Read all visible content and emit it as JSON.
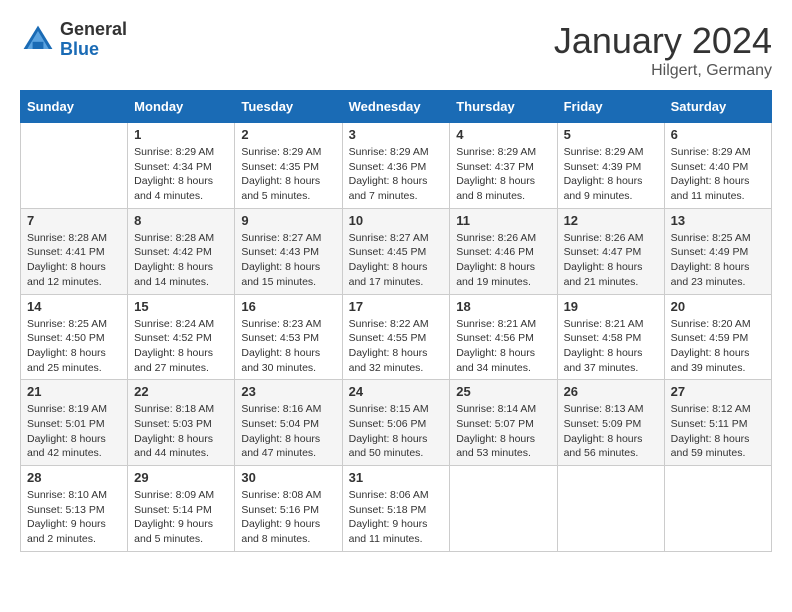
{
  "header": {
    "logo_general": "General",
    "logo_blue": "Blue",
    "month_title": "January 2024",
    "location": "Hilgert, Germany"
  },
  "days_of_week": [
    "Sunday",
    "Monday",
    "Tuesday",
    "Wednesday",
    "Thursday",
    "Friday",
    "Saturday"
  ],
  "weeks": [
    [
      {
        "day": "",
        "sunrise": "",
        "sunset": "",
        "daylight": ""
      },
      {
        "day": "1",
        "sunrise": "Sunrise: 8:29 AM",
        "sunset": "Sunset: 4:34 PM",
        "daylight": "Daylight: 8 hours and 4 minutes."
      },
      {
        "day": "2",
        "sunrise": "Sunrise: 8:29 AM",
        "sunset": "Sunset: 4:35 PM",
        "daylight": "Daylight: 8 hours and 5 minutes."
      },
      {
        "day": "3",
        "sunrise": "Sunrise: 8:29 AM",
        "sunset": "Sunset: 4:36 PM",
        "daylight": "Daylight: 8 hours and 7 minutes."
      },
      {
        "day": "4",
        "sunrise": "Sunrise: 8:29 AM",
        "sunset": "Sunset: 4:37 PM",
        "daylight": "Daylight: 8 hours and 8 minutes."
      },
      {
        "day": "5",
        "sunrise": "Sunrise: 8:29 AM",
        "sunset": "Sunset: 4:39 PM",
        "daylight": "Daylight: 8 hours and 9 minutes."
      },
      {
        "day": "6",
        "sunrise": "Sunrise: 8:29 AM",
        "sunset": "Sunset: 4:40 PM",
        "daylight": "Daylight: 8 hours and 11 minutes."
      }
    ],
    [
      {
        "day": "7",
        "sunrise": "Sunrise: 8:28 AM",
        "sunset": "Sunset: 4:41 PM",
        "daylight": "Daylight: 8 hours and 12 minutes."
      },
      {
        "day": "8",
        "sunrise": "Sunrise: 8:28 AM",
        "sunset": "Sunset: 4:42 PM",
        "daylight": "Daylight: 8 hours and 14 minutes."
      },
      {
        "day": "9",
        "sunrise": "Sunrise: 8:27 AM",
        "sunset": "Sunset: 4:43 PM",
        "daylight": "Daylight: 8 hours and 15 minutes."
      },
      {
        "day": "10",
        "sunrise": "Sunrise: 8:27 AM",
        "sunset": "Sunset: 4:45 PM",
        "daylight": "Daylight: 8 hours and 17 minutes."
      },
      {
        "day": "11",
        "sunrise": "Sunrise: 8:26 AM",
        "sunset": "Sunset: 4:46 PM",
        "daylight": "Daylight: 8 hours and 19 minutes."
      },
      {
        "day": "12",
        "sunrise": "Sunrise: 8:26 AM",
        "sunset": "Sunset: 4:47 PM",
        "daylight": "Daylight: 8 hours and 21 minutes."
      },
      {
        "day": "13",
        "sunrise": "Sunrise: 8:25 AM",
        "sunset": "Sunset: 4:49 PM",
        "daylight": "Daylight: 8 hours and 23 minutes."
      }
    ],
    [
      {
        "day": "14",
        "sunrise": "Sunrise: 8:25 AM",
        "sunset": "Sunset: 4:50 PM",
        "daylight": "Daylight: 8 hours and 25 minutes."
      },
      {
        "day": "15",
        "sunrise": "Sunrise: 8:24 AM",
        "sunset": "Sunset: 4:52 PM",
        "daylight": "Daylight: 8 hours and 27 minutes."
      },
      {
        "day": "16",
        "sunrise": "Sunrise: 8:23 AM",
        "sunset": "Sunset: 4:53 PM",
        "daylight": "Daylight: 8 hours and 30 minutes."
      },
      {
        "day": "17",
        "sunrise": "Sunrise: 8:22 AM",
        "sunset": "Sunset: 4:55 PM",
        "daylight": "Daylight: 8 hours and 32 minutes."
      },
      {
        "day": "18",
        "sunrise": "Sunrise: 8:21 AM",
        "sunset": "Sunset: 4:56 PM",
        "daylight": "Daylight: 8 hours and 34 minutes."
      },
      {
        "day": "19",
        "sunrise": "Sunrise: 8:21 AM",
        "sunset": "Sunset: 4:58 PM",
        "daylight": "Daylight: 8 hours and 37 minutes."
      },
      {
        "day": "20",
        "sunrise": "Sunrise: 8:20 AM",
        "sunset": "Sunset: 4:59 PM",
        "daylight": "Daylight: 8 hours and 39 minutes."
      }
    ],
    [
      {
        "day": "21",
        "sunrise": "Sunrise: 8:19 AM",
        "sunset": "Sunset: 5:01 PM",
        "daylight": "Daylight: 8 hours and 42 minutes."
      },
      {
        "day": "22",
        "sunrise": "Sunrise: 8:18 AM",
        "sunset": "Sunset: 5:03 PM",
        "daylight": "Daylight: 8 hours and 44 minutes."
      },
      {
        "day": "23",
        "sunrise": "Sunrise: 8:16 AM",
        "sunset": "Sunset: 5:04 PM",
        "daylight": "Daylight: 8 hours and 47 minutes."
      },
      {
        "day": "24",
        "sunrise": "Sunrise: 8:15 AM",
        "sunset": "Sunset: 5:06 PM",
        "daylight": "Daylight: 8 hours and 50 minutes."
      },
      {
        "day": "25",
        "sunrise": "Sunrise: 8:14 AM",
        "sunset": "Sunset: 5:07 PM",
        "daylight": "Daylight: 8 hours and 53 minutes."
      },
      {
        "day": "26",
        "sunrise": "Sunrise: 8:13 AM",
        "sunset": "Sunset: 5:09 PM",
        "daylight": "Daylight: 8 hours and 56 minutes."
      },
      {
        "day": "27",
        "sunrise": "Sunrise: 8:12 AM",
        "sunset": "Sunset: 5:11 PM",
        "daylight": "Daylight: 8 hours and 59 minutes."
      }
    ],
    [
      {
        "day": "28",
        "sunrise": "Sunrise: 8:10 AM",
        "sunset": "Sunset: 5:13 PM",
        "daylight": "Daylight: 9 hours and 2 minutes."
      },
      {
        "day": "29",
        "sunrise": "Sunrise: 8:09 AM",
        "sunset": "Sunset: 5:14 PM",
        "daylight": "Daylight: 9 hours and 5 minutes."
      },
      {
        "day": "30",
        "sunrise": "Sunrise: 8:08 AM",
        "sunset": "Sunset: 5:16 PM",
        "daylight": "Daylight: 9 hours and 8 minutes."
      },
      {
        "day": "31",
        "sunrise": "Sunrise: 8:06 AM",
        "sunset": "Sunset: 5:18 PM",
        "daylight": "Daylight: 9 hours and 11 minutes."
      },
      {
        "day": "",
        "sunrise": "",
        "sunset": "",
        "daylight": ""
      },
      {
        "day": "",
        "sunrise": "",
        "sunset": "",
        "daylight": ""
      },
      {
        "day": "",
        "sunrise": "",
        "sunset": "",
        "daylight": ""
      }
    ]
  ]
}
